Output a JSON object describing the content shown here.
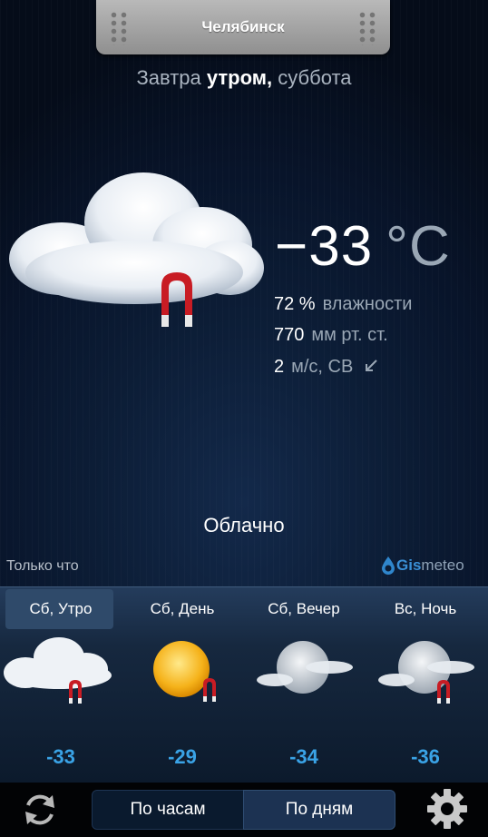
{
  "header": {
    "city": "Челябинск"
  },
  "subtitle": {
    "prefix": "Завтра",
    "bold": "утром,",
    "suffix": "суббота"
  },
  "current": {
    "temperature": "−33",
    "unit": "°C",
    "humidity_value": "72 %",
    "humidity_label": "влажности",
    "pressure_value": "770",
    "pressure_label": "мм рт. ст.",
    "wind_value": "2",
    "wind_label": "м/с, СВ",
    "condition": "Облачно",
    "icon": "cloud-magnet-icon"
  },
  "footer": {
    "updated": "Только что",
    "brand_gis": "Gis",
    "brand_meteo": "meteo"
  },
  "forecast": [
    {
      "label": "Сб, Утро",
      "temp": "-33",
      "icon": "cloud-magnet-icon",
      "selected": true
    },
    {
      "label": "Сб, День",
      "temp": "-29",
      "icon": "sun-magnet-icon",
      "selected": false
    },
    {
      "label": "Сб, Вечер",
      "temp": "-34",
      "icon": "moon-cloud-icon",
      "selected": false
    },
    {
      "label": "Вс, Ночь",
      "temp": "-36",
      "icon": "moon-cloud-magnet-icon",
      "selected": false
    }
  ],
  "bottom": {
    "hours_label": "По часам",
    "days_label": "По дням",
    "active": "days"
  },
  "colors": {
    "accent_temp": "#3aa3e6",
    "background": "#0c1d36",
    "tab": "#a5a5a5"
  }
}
